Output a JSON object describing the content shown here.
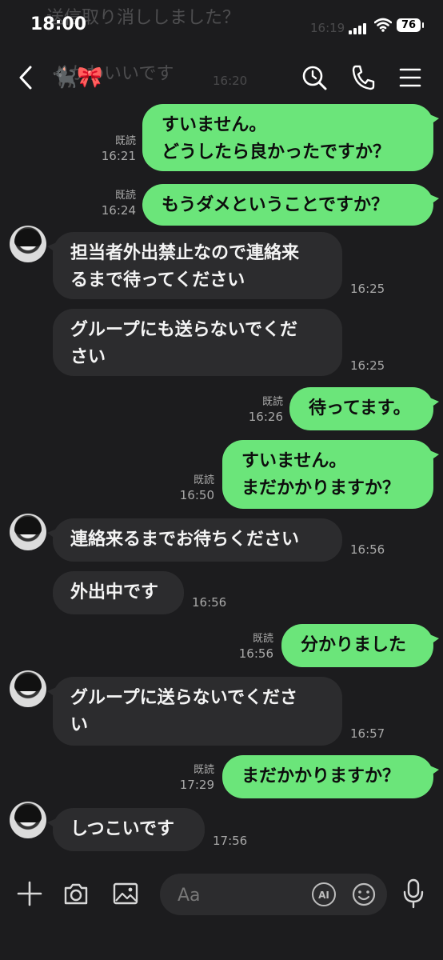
{
  "status_bar": {
    "time": "18:00",
    "battery": "76"
  },
  "background_ghost": {
    "line1": "送信取り消ししました？",
    "time1": "16:19",
    "line2": "かわいいです",
    "time2": "16:20"
  },
  "header": {
    "contact_name": "🐈‍⬛🎀"
  },
  "messages": [
    {
      "dir": "out",
      "lines": [
        "すいません。",
        "どうしたら良かったですか？"
      ],
      "read": "既読",
      "time": "16:21"
    },
    {
      "dir": "out",
      "lines": [
        "もうダメということですか？"
      ],
      "read": "既読",
      "time": "16:24"
    },
    {
      "dir": "in",
      "lines": [
        "担当者外出禁止なので連絡来",
        "るまで待ってください"
      ],
      "time": "16:25"
    },
    {
      "dir": "in",
      "lines": [
        "グループにも送らないでくだ",
        "さい"
      ],
      "time": "16:25"
    },
    {
      "dir": "out",
      "lines": [
        "待ってます。"
      ],
      "read": "既読",
      "time": "16:26"
    },
    {
      "dir": "out",
      "lines": [
        "すいません。",
        "まだかかりますか？"
      ],
      "read": "既読",
      "time": "16:50"
    },
    {
      "dir": "in",
      "lines": [
        "連絡来るまでお待ちください"
      ],
      "time": "16:56"
    },
    {
      "dir": "in",
      "lines": [
        "外出中です"
      ],
      "time": "16:56"
    },
    {
      "dir": "out",
      "lines": [
        "分かりました"
      ],
      "read": "既読",
      "time": "16:56"
    },
    {
      "dir": "in",
      "lines": [
        "グループに送らないでくださ",
        "い"
      ],
      "time": "16:57"
    },
    {
      "dir": "out",
      "lines": [
        "まだかかりますか？"
      ],
      "read": "既読",
      "time": "17:29"
    },
    {
      "dir": "in",
      "lines": [
        "しつこいです"
      ],
      "time": "17:56"
    }
  ],
  "input_bar": {
    "placeholder": "Aa",
    "ai_label": "AI"
  },
  "colors": {
    "outgoing": "#6be57a",
    "incoming": "#2c2c2e",
    "background": "#1c1c1e"
  },
  "icons": [
    "back-chevron-icon",
    "search-icon",
    "phone-icon",
    "menu-icon",
    "plus-icon",
    "camera-icon",
    "image-icon",
    "ai-icon",
    "emoji-icon",
    "microphone-icon",
    "avatar"
  ]
}
